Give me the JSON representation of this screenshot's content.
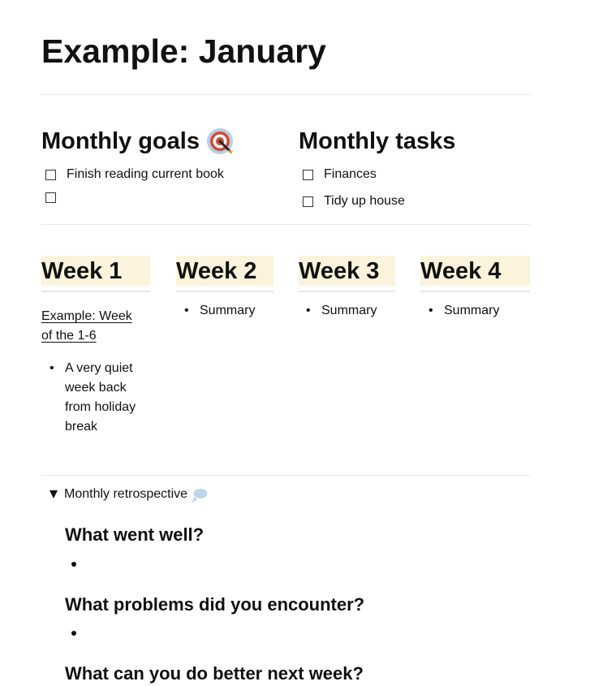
{
  "page": {
    "title": "Example: January"
  },
  "goals": {
    "heading": "Monthly goals",
    "items": [
      "Finish reading current book",
      ""
    ]
  },
  "tasks": {
    "heading": "Monthly tasks",
    "items": [
      "Finances",
      "Tidy up house"
    ]
  },
  "weeks": [
    {
      "title": "Week 1",
      "link": "Example: Week of the 1-6",
      "bullet": "A very quiet week back from holiday break"
    },
    {
      "title": "Week 2",
      "bullet": "Summary"
    },
    {
      "title": "Week 3",
      "bullet": "Summary"
    },
    {
      "title": "Week 4",
      "bullet": "Summary"
    }
  ],
  "retrospective": {
    "toggle_label": "Monthly retrospective",
    "questions": [
      "What went well?",
      "What problems did you encounter?",
      "What can you do better next week?"
    ]
  },
  "icons": {
    "goals": "target-icon",
    "retrospective": "thought-bubble-icon"
  },
  "colors": {
    "week_highlight": "#fbf3db"
  }
}
